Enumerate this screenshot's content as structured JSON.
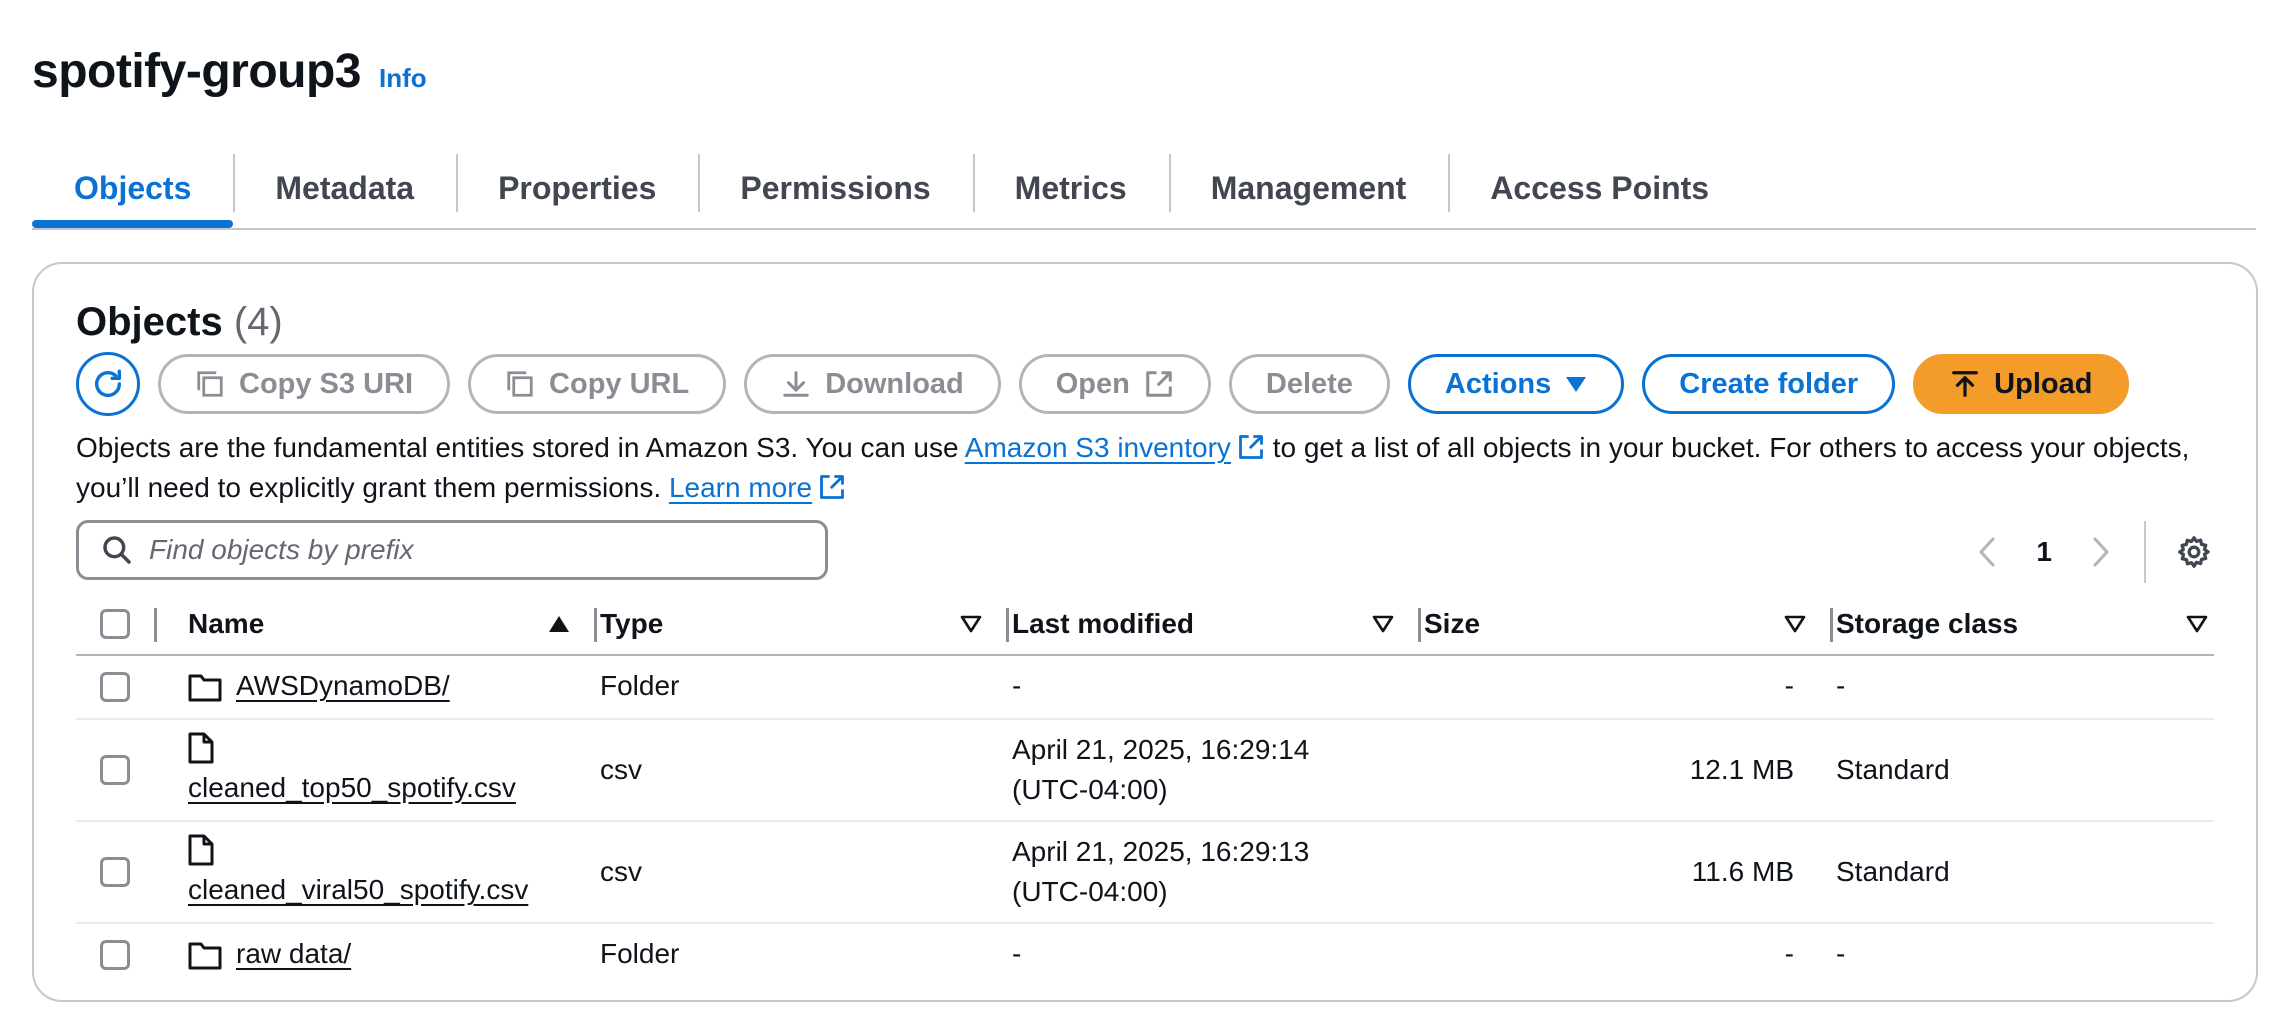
{
  "bucket": {
    "name": "spotify-group3",
    "info_label": "Info"
  },
  "tabs": [
    {
      "label": "Objects",
      "active": true
    },
    {
      "label": "Metadata"
    },
    {
      "label": "Properties"
    },
    {
      "label": "Permissions"
    },
    {
      "label": "Metrics"
    },
    {
      "label": "Management"
    },
    {
      "label": "Access Points"
    }
  ],
  "objects": {
    "heading": "Objects",
    "count": "(4)",
    "toolbar": {
      "copy_s3_uri": "Copy S3 URI",
      "copy_url": "Copy URL",
      "download": "Download",
      "open": "Open",
      "delete": "Delete",
      "actions": "Actions",
      "create_folder": "Create folder",
      "upload": "Upload"
    },
    "description": {
      "part1": "Objects are the fundamental entities stored in Amazon S3. You can use ",
      "inventory_link": "Amazon S3 inventory",
      "part2": " to get a list of all objects in your bucket. For others to access your objects, you’ll need to explicitly grant them permissions. ",
      "learn_more": "Learn more"
    },
    "search": {
      "placeholder": "Find objects by prefix"
    },
    "pagination": {
      "current_page": "1"
    },
    "columns": {
      "name": "Name",
      "type": "Type",
      "last_modified": "Last modified",
      "size": "Size",
      "storage_class": "Storage class"
    },
    "rows": [
      {
        "icon": "folder-icon",
        "name": "AWSDynamoDB/",
        "type": "Folder",
        "modified_date": "-",
        "modified_tz": "",
        "size": "-",
        "storage": "-"
      },
      {
        "icon": "file-icon",
        "name": "cleaned_top50_spotify.csv",
        "type": "csv",
        "modified_date": "April 21, 2025, 16:29:14",
        "modified_tz": "(UTC-04:00)",
        "size": "12.1 MB",
        "storage": "Standard"
      },
      {
        "icon": "file-icon",
        "name": "cleaned_viral50_spotify.csv",
        "type": "csv",
        "modified_date": "April 21, 2025, 16:29:13",
        "modified_tz": "(UTC-04:00)",
        "size": "11.6 MB",
        "storage": "Standard"
      },
      {
        "icon": "folder-icon",
        "name": "raw data/",
        "type": "Folder",
        "modified_date": "-",
        "modified_tz": "",
        "size": "-",
        "storage": "-"
      }
    ]
  },
  "colors": {
    "accent": "#0972d3",
    "upload": "#f39c2a",
    "border": "#c6c6cd"
  }
}
